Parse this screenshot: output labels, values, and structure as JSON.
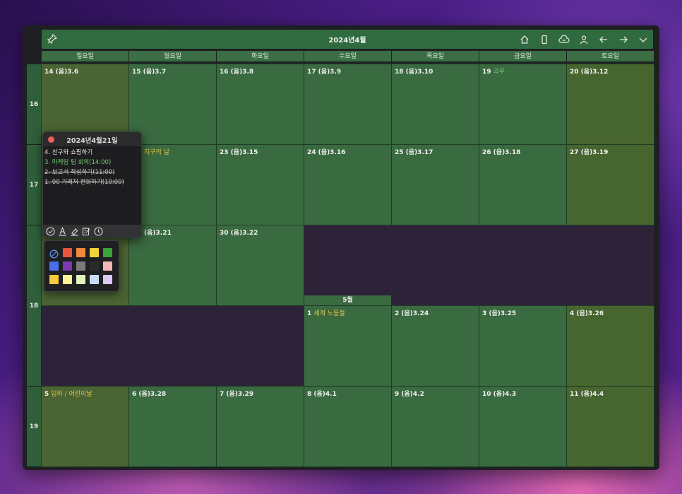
{
  "toolbar": {
    "title": "2024년4월",
    "icons": [
      "pin-icon",
      "home-icon",
      "phone-icon",
      "cloud-icon",
      "person-icon",
      "arrow-left-icon",
      "arrow-right-icon",
      "chevron-down-icon"
    ]
  },
  "weekdays": [
    "일요일",
    "월요일",
    "화요일",
    "수요일",
    "목요일",
    "금요일",
    "토요일"
  ],
  "weeks": [
    "16",
    "17",
    "18",
    "19"
  ],
  "days": {
    "w1": [
      {
        "num": "14",
        "rest": "(음)3.6",
        "hol": ""
      },
      {
        "num": "15",
        "rest": "(음)3.7",
        "hol": ""
      },
      {
        "num": "16",
        "rest": "(음)3.8",
        "hol": ""
      },
      {
        "num": "17",
        "rest": "(음)3.9",
        "hol": ""
      },
      {
        "num": "18",
        "rest": "(음)3.10",
        "hol": ""
      },
      {
        "num": "19",
        "rest": "",
        "hol": "곡우"
      },
      {
        "num": "20",
        "rest": "(음)3.12",
        "hol": ""
      }
    ],
    "w2": [
      {
        "num": "",
        "rest": "",
        "hol": ""
      },
      {
        "num": "",
        "rest": "",
        "hol": "지구의 날"
      },
      {
        "num": "23",
        "rest": "(음)3.15",
        "hol": ""
      },
      {
        "num": "24",
        "rest": "(음)3.16",
        "hol": ""
      },
      {
        "num": "25",
        "rest": "(음)3.17",
        "hol": ""
      },
      {
        "num": "26",
        "rest": "(음)3.18",
        "hol": ""
      },
      {
        "num": "27",
        "rest": "(음)3.19",
        "hol": ""
      }
    ],
    "w3": [
      {
        "num": "",
        "rest": "",
        "hol": ""
      },
      {
        "num": "",
        "rest": "(음)3.21",
        "hol": ""
      },
      {
        "num": "30",
        "rest": "(음)3.22",
        "hol": ""
      }
    ],
    "w3b": [
      {
        "num": "1",
        "rest": "",
        "hol": "세계 노동절"
      },
      {
        "num": "2",
        "rest": "(음)3.24",
        "hol": ""
      },
      {
        "num": "3",
        "rest": "(음)3.25",
        "hol": ""
      },
      {
        "num": "4",
        "rest": "(음)3.26",
        "hol": ""
      }
    ],
    "w4": [
      {
        "num": "5",
        "rest": "",
        "hol": "입하 / 어린이날"
      },
      {
        "num": "6",
        "rest": "(음)3.28",
        "hol": ""
      },
      {
        "num": "7",
        "rest": "(음)3.29",
        "hol": ""
      },
      {
        "num": "8",
        "rest": "(음)4.1",
        "hol": ""
      },
      {
        "num": "9",
        "rest": "(음)4.2",
        "hol": ""
      },
      {
        "num": "10",
        "rest": "(음)4.3",
        "hol": ""
      },
      {
        "num": "11",
        "rest": "(음)4.4",
        "hol": ""
      }
    ]
  },
  "month_tag": "5월",
  "popup": {
    "title": "2024년4월21일",
    "items": [
      "4. 친구와 쇼핑하기",
      "3. 마케팅 팀 회의(14:00)",
      "2. 보고서 작성하기(11:00)",
      "1. 00 거래처 전화하기(10:00)"
    ],
    "tools": [
      "check-circle-icon",
      "text-color-icon",
      "highlight-icon",
      "edit-note-icon",
      "clock-icon"
    ]
  },
  "palette": {
    "colors": [
      "none",
      "#e8553a",
      "#f08a3a",
      "#f2d33a",
      "#3aa33a",
      "#4a6ee8",
      "#7a3ab0",
      "#7a7a7a",
      "#2a2a2a",
      "#f4b6b6",
      "#f4cc3a",
      "#fbf29a",
      "#dff2c0",
      "#c8dcf4",
      "#dcc8f4"
    ]
  },
  "colors": {
    "cell": "#3a6a40",
    "holiday": "#e8c14a",
    "solar_term": "#6fd06f",
    "toolbar": "#2f6b3f"
  }
}
